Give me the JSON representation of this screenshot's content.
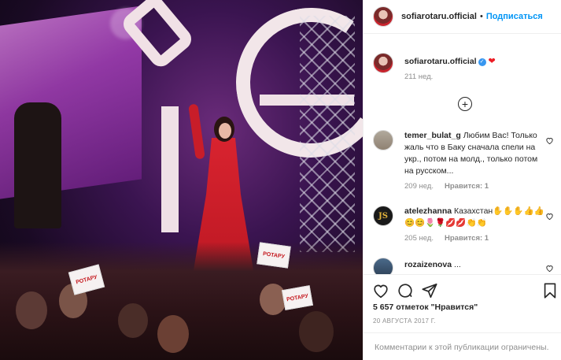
{
  "post": {
    "author": "sofiarotaru.official",
    "follow_label": "Подписаться",
    "separator": "•",
    "caption_heart": "❤",
    "caption_time": "211 нед.",
    "load_more": "+"
  },
  "comments": [
    {
      "user": "temer_bulat_g",
      "text": "Любим Вас! Только жаль что в Баку сначала спели на укр., потом на молд., только потом на русском...",
      "time": "209 нед.",
      "reply_label": "Нравится: 1"
    },
    {
      "user": "atelezhanna",
      "text": "Казахстан✋✋✋👍👍😊😊🌷🌹💋💋👏👏",
      "time": "205 нед.",
      "reply_label": "Нравится: 1",
      "avatar_text": "JS"
    },
    {
      "user": "rozaizenova",
      "text": "..."
    }
  ],
  "stats": {
    "likes": "5 657 отметок \"Нравится\"",
    "date": "20 АВГУСТА 2017 Г."
  },
  "footer": {
    "comments_closed": "Комментарии к этой публикации ограничены."
  },
  "photo": {
    "signs": [
      "РОТАРУ",
      "РОТАРУ",
      "РОТАРУ"
    ]
  },
  "icons": {
    "heart": "heart-icon",
    "comment": "comment-icon",
    "share": "share-icon",
    "bookmark": "bookmark-icon",
    "verified": "verified-icon"
  },
  "colors": {
    "link": "#0095f6",
    "muted": "#8e8e8e",
    "text": "#262626",
    "verified": "#3897f0",
    "dress": "#d8232f"
  }
}
